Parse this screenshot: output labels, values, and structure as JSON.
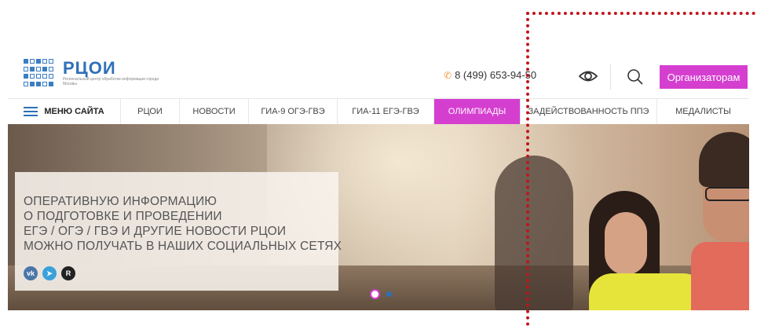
{
  "header": {
    "logo_title": "РЦОИ",
    "logo_subtitle": "Региональный центр обработки информации города Москвы",
    "phone": "8 (499) 653-94-50",
    "organizers_button": "Организаторам"
  },
  "nav": {
    "menu_label": "МЕНЮ САЙТА",
    "items": [
      "РЦОИ",
      "НОВОСТИ",
      "ГИА-9 ОГЭ-ГВЭ",
      "ГИА-11 ЕГЭ-ГВЭ",
      "ОЛИМПИАДЫ",
      "ЗАДЕЙСТВОВАННОСТЬ ППЭ",
      "МЕДАЛИСТЫ"
    ],
    "active": "ОЛИМПИАДЫ"
  },
  "hero": {
    "lines": [
      "ОПЕРАТИВНУЮ ИНФОРМАЦИЮ",
      "О ПОДГОТОВКЕ И ПРОВЕДЕНИИ",
      "ЕГЭ / ОГЭ / ГВЭ  И ДРУГИЕ НОВОСТИ РЦОИ",
      "МОЖНО ПОЛУЧАТЬ В НАШИХ СОЦИАЛЬНЫХ СЕТЯХ"
    ],
    "socials": [
      {
        "icon": "vk-icon",
        "glyph": "vk"
      },
      {
        "icon": "telegram-icon",
        "glyph": "➤"
      },
      {
        "icon": "rutube-icon",
        "glyph": "R"
      }
    ],
    "slides": {
      "count": 2,
      "active": 1
    }
  },
  "colors": {
    "accent": "#d53fd0",
    "brand": "#2f6fb8",
    "highlight": "#c0151b"
  }
}
